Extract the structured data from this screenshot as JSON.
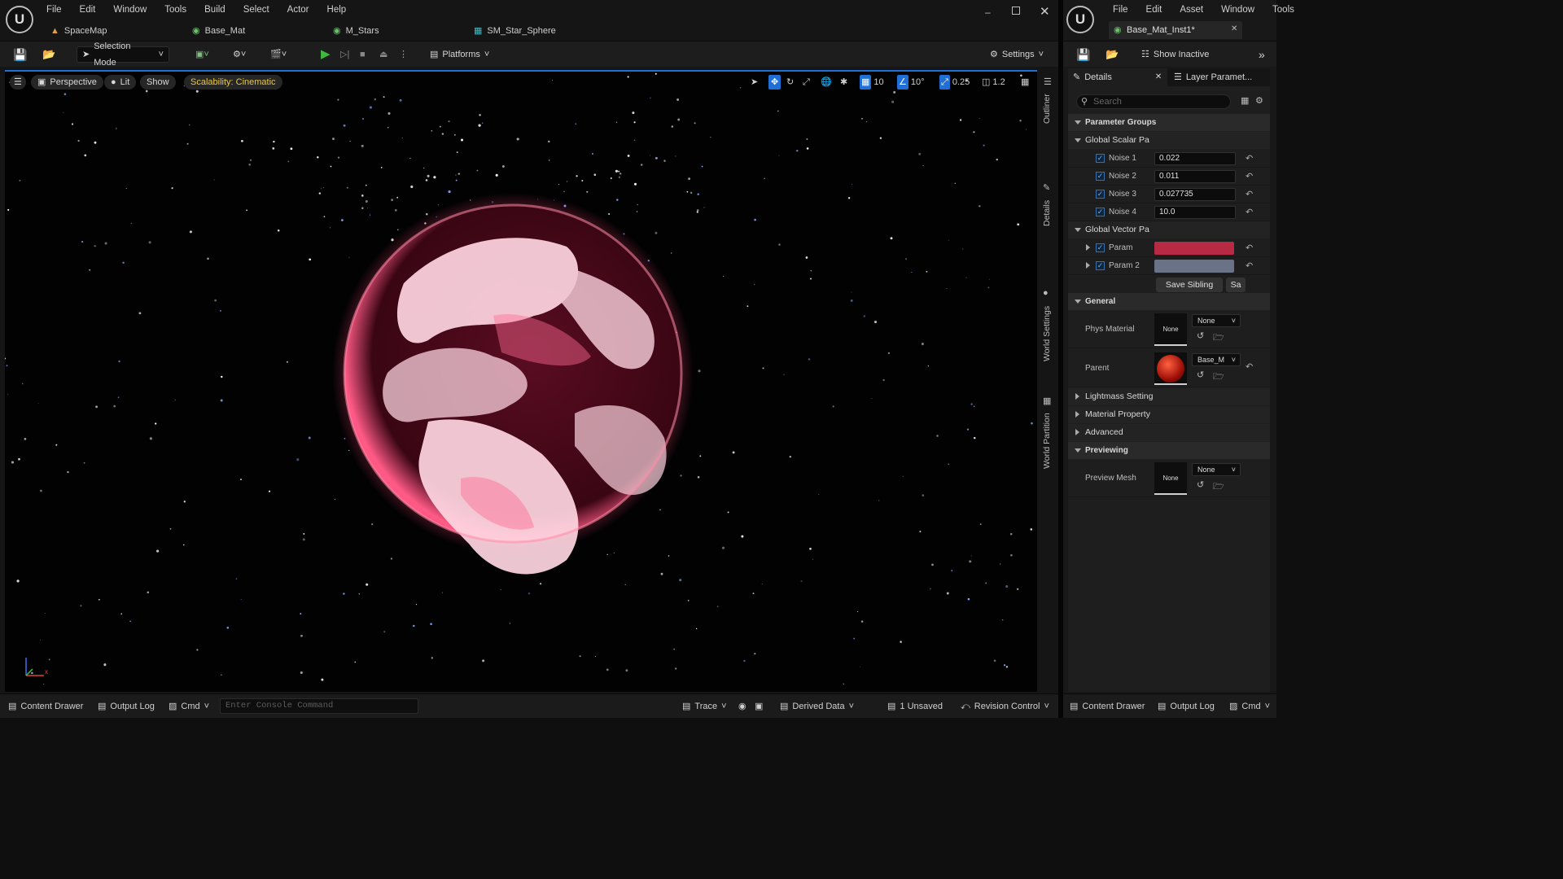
{
  "left_window": {
    "menu": [
      "File",
      "Edit",
      "Window",
      "Tools",
      "Build",
      "Select",
      "Actor",
      "Help"
    ],
    "tabs": [
      {
        "label": "SpaceMap",
        "icon": "level-icon",
        "color": "#e0a040"
      },
      {
        "label": "Base_Mat",
        "icon": "material-icon",
        "color": "#6ac06a"
      },
      {
        "label": "M_Stars",
        "icon": "material-icon",
        "color": "#6ac06a"
      },
      {
        "label": "SM_Star_Sphere",
        "icon": "static-mesh-icon",
        "color": "#40b8c8"
      }
    ],
    "toolbar": {
      "selection_mode": "Selection Mode",
      "platforms": "Platforms",
      "settings": "Settings"
    },
    "viewport": {
      "perspective": "Perspective",
      "lit": "Lit",
      "show": "Show",
      "scalability": "Scalability: Cinematic",
      "grid_value": "10",
      "angle_value": "10°",
      "scale_value": "0.25",
      "camera_speed": "1.2"
    },
    "side_labels": [
      "Outliner",
      "Details",
      "World Settings",
      "World Partition"
    ],
    "status": {
      "content_drawer": "Content Drawer",
      "output_log": "Output Log",
      "cmd": "Cmd",
      "console_placeholder": "Enter Console Command",
      "trace": "Trace",
      "derived_data": "Derived Data",
      "unsaved": "1 Unsaved",
      "revision_control": "Revision Control"
    },
    "window_controls": [
      "minimize",
      "maximize",
      "close"
    ]
  },
  "right_window": {
    "menu": [
      "File",
      "Edit",
      "Asset",
      "Window",
      "Tools"
    ],
    "asset_tab": "Base_Mat_Inst1*",
    "show_inactive": "Show Inactive",
    "details": {
      "tab_details": "Details",
      "tab_layers": "Layer Paramet...",
      "search_placeholder": "Search",
      "parameter_groups": "Parameter Groups",
      "global_scalar": "Global Scalar Pa",
      "scalars": [
        {
          "name": "Noise 1",
          "value": "0.022"
        },
        {
          "name": "Noise 2",
          "value": "0.011"
        },
        {
          "name": "Noise 3",
          "value": "0.027735"
        },
        {
          "name": "Noise 4",
          "value": "10.0"
        }
      ],
      "global_vector": "Global Vector Pa",
      "vectors": [
        {
          "name": "Param",
          "color": "#b82a44"
        },
        {
          "name": "Param 2",
          "color": "#6a7288"
        }
      ],
      "save_sibling": "Save Sibling",
      "save_child": "Sa",
      "general": "General",
      "phys_material": "Phys Material",
      "phys_value": "None",
      "phys_thumb": "None",
      "parent": "Parent",
      "parent_value": "Base_M",
      "collapsed_sections": [
        "Lightmass Setting",
        "Material Property",
        "Advanced"
      ],
      "previewing": "Previewing",
      "preview_mesh": "Preview Mesh",
      "preview_value": "None",
      "preview_thumb": "None"
    },
    "status": {
      "content_drawer": "Content Drawer",
      "output_log": "Output Log",
      "cmd": "Cmd"
    }
  },
  "colors": {
    "accent_blue": "#1f6fd6",
    "play_green": "#3fb83f",
    "scalability_yellow": "#e8c84a",
    "planet_pink": "#ff7fa0"
  }
}
